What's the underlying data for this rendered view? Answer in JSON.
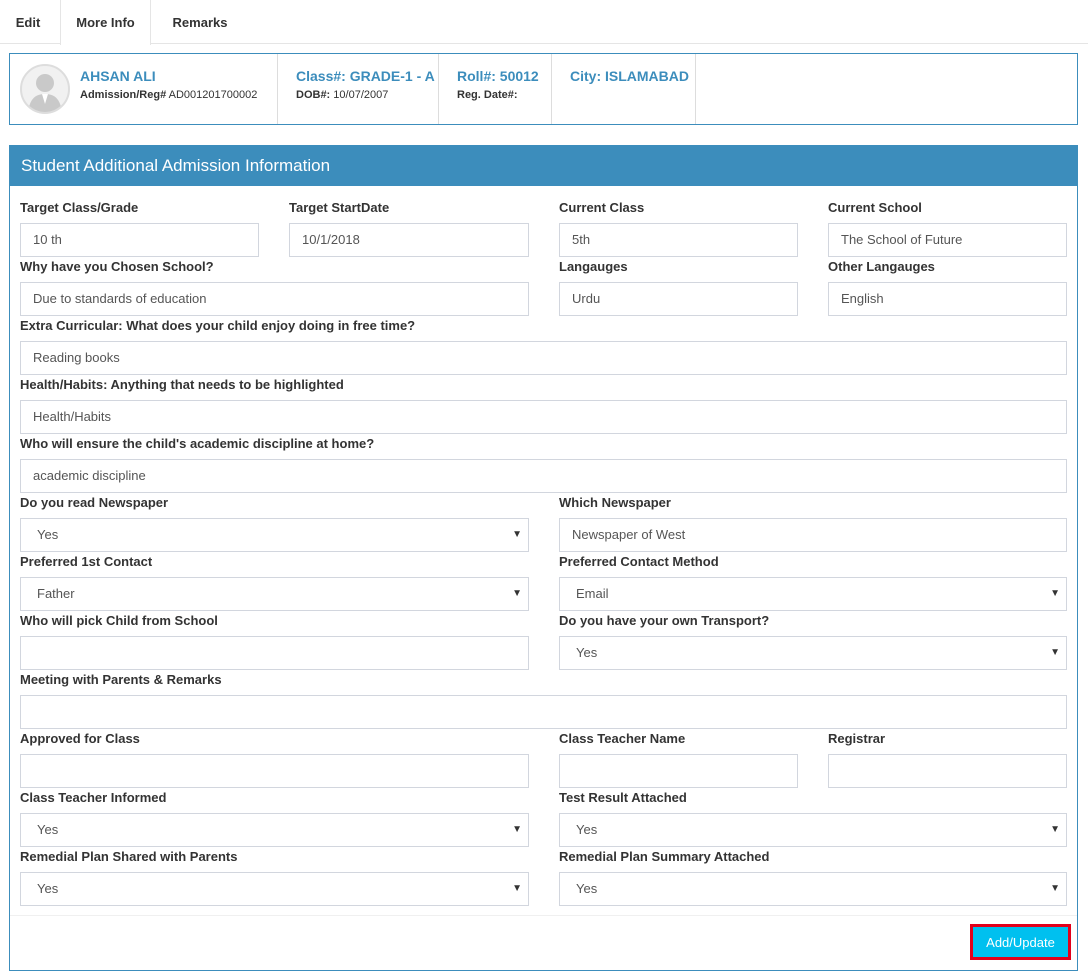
{
  "tabs": [
    {
      "label": "Edit"
    },
    {
      "label": "More Info"
    },
    {
      "label": "Remarks"
    }
  ],
  "student": {
    "name": "AHSAN ALI",
    "admission_label": "Admission/Reg#",
    "admission_value": "AD001201700002",
    "class_title": "Class#: GRADE-1 - A",
    "dob_label": "DOB#:",
    "dob_value": "10/07/2007",
    "roll_title": "Roll#: 50012",
    "reg_date_label": "Reg. Date#:",
    "city_title": "City: ISLAMABAD"
  },
  "panel": {
    "title": "Student Additional Admission Information"
  },
  "form": {
    "target_class": {
      "label": "Target Class/Grade",
      "value": "10 th"
    },
    "target_start": {
      "label": "Target StartDate",
      "value": "10/1/2018"
    },
    "current_class": {
      "label": "Current Class",
      "value": "5th"
    },
    "current_school": {
      "label": "Current School",
      "value": "The School of Future"
    },
    "why_school": {
      "label": "Why have you Chosen School?",
      "value": "Due to standards of education"
    },
    "languages": {
      "label": "Langauges",
      "value": "Urdu"
    },
    "other_languages": {
      "label": "Other Langauges",
      "value": "English"
    },
    "extra_curricular": {
      "label": "Extra Curricular: What does your child enjoy doing in free time?",
      "value": "Reading books"
    },
    "health": {
      "label": "Health/Habits: Anything that needs to be highlighted",
      "value": "Health/Habits"
    },
    "discipline": {
      "label": "Who will ensure the child's academic discipline at home?",
      "value": "academic discipline"
    },
    "read_newspaper": {
      "label": "Do you read Newspaper",
      "value": "Yes"
    },
    "which_newspaper": {
      "label": "Which Newspaper",
      "value": "Newspaper of West"
    },
    "preferred_contact": {
      "label": "Preferred 1st Contact",
      "value": "Father"
    },
    "contact_method": {
      "label": "Preferred Contact Method",
      "value": "Email"
    },
    "pick_child": {
      "label": "Who will pick Child from School",
      "value": ""
    },
    "own_transport": {
      "label": "Do you have your own Transport?",
      "value": "Yes"
    },
    "meeting": {
      "label": "Meeting with Parents & Remarks",
      "value": ""
    },
    "approved_class": {
      "label": "Approved for Class",
      "value": ""
    },
    "teacher_name": {
      "label": "Class Teacher Name",
      "value": ""
    },
    "registrar": {
      "label": "Registrar",
      "value": ""
    },
    "teacher_informed": {
      "label": "Class Teacher Informed",
      "value": "Yes"
    },
    "test_result": {
      "label": "Test Result Attached",
      "value": "Yes"
    },
    "remedial_shared": {
      "label": "Remedial Plan Shared with Parents",
      "value": "Yes"
    },
    "remedial_summary": {
      "label": "Remedial Plan Summary Attached",
      "value": "Yes"
    }
  },
  "caret": "▼",
  "submit_label": "Add/Update",
  "colors": {
    "primary": "#3c8dbc",
    "button": "#00c0ef",
    "highlight": "#e3001b"
  }
}
